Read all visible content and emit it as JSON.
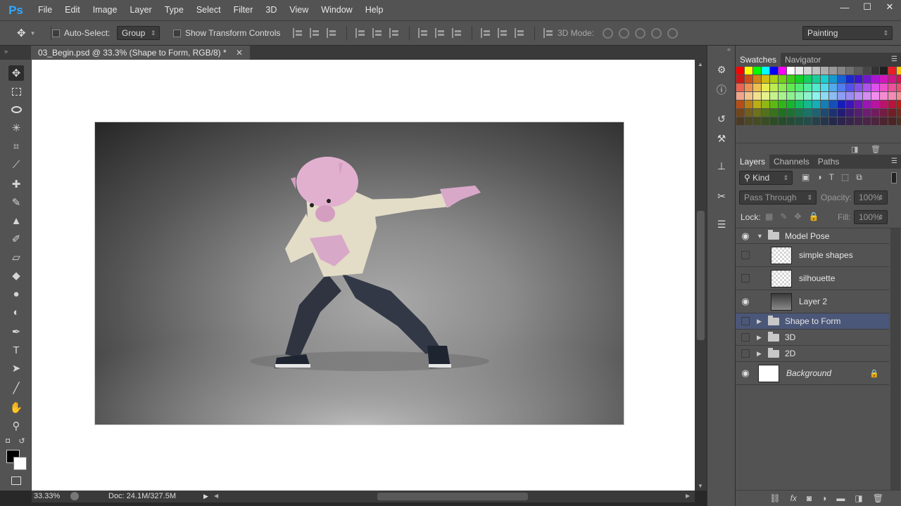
{
  "app": {
    "logo": "Ps"
  },
  "menu": [
    "File",
    "Edit",
    "Image",
    "Layer",
    "Type",
    "Select",
    "Filter",
    "3D",
    "View",
    "Window",
    "Help"
  ],
  "window_controls": {
    "minimize": "—",
    "maximize": "☐",
    "close": "✕"
  },
  "options": {
    "auto_select_label": "Auto-Select:",
    "auto_select_value": "Group",
    "show_transform_label": "Show Transform Controls",
    "mode_3d_label": "3D Mode:",
    "workspace": "Painting"
  },
  "document": {
    "tab_title": "03_Begin.psd @ 33.3% (Shape to Form, RGB/8) *",
    "close": "✕"
  },
  "status": {
    "zoom": "33.33%",
    "doc": "Doc: 24.1M/327.5M"
  },
  "swatches_panel": {
    "tabs": [
      "Swatches",
      "Navigator"
    ]
  },
  "layers_panel": {
    "tabs": [
      "Layers",
      "Channels",
      "Paths"
    ],
    "filter_kind": "Kind",
    "blend_mode": "Pass Through",
    "opacity_label": "Opacity:",
    "opacity_value": "100%",
    "lock_label": "Lock:",
    "fill_label": "Fill:",
    "fill_value": "100%",
    "layers": [
      {
        "name": "Model Pose",
        "type": "group",
        "visible": true,
        "expanded": true,
        "indent": 0
      },
      {
        "name": "simple shapes",
        "type": "layer",
        "visible": false,
        "indent": 1
      },
      {
        "name": "silhouette",
        "type": "layer",
        "visible": false,
        "indent": 1
      },
      {
        "name": "Layer 2",
        "type": "layer",
        "visible": true,
        "indent": 1
      },
      {
        "name": "Shape to Form",
        "type": "group",
        "visible": false,
        "expanded": false,
        "selected": true,
        "indent": 0
      },
      {
        "name": "3D",
        "type": "group",
        "visible": false,
        "expanded": false,
        "indent": 0
      },
      {
        "name": "2D",
        "type": "group",
        "visible": false,
        "expanded": false,
        "indent": 0
      },
      {
        "name": "Background",
        "type": "background",
        "visible": true,
        "locked": true,
        "indent": 0
      }
    ]
  },
  "colors": {
    "accent": "#31a8ff",
    "selected_row": "#4b5778",
    "foreground": "#000000",
    "background": "#ffffff"
  }
}
